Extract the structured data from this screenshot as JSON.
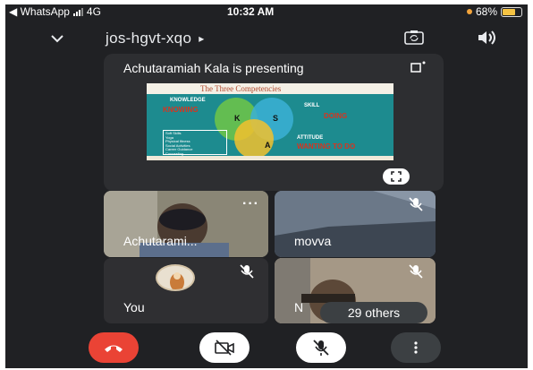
{
  "status_bar": {
    "back_app": "◀ WhatsApp",
    "network": "4G",
    "time": "10:32 AM",
    "battery": "68%",
    "battery_level": 0.68
  },
  "meeting": {
    "code": "jos-hgvt-xqo",
    "code_chevron": "▸"
  },
  "presentation": {
    "title": "Achutaramiah Kala is presenting",
    "slide": {
      "heading": "The Three Competencies",
      "knowledge": "KNOWLEDGE",
      "skill": "SKILL",
      "knowing": "KNOWING",
      "doing": "DOING",
      "attitude": "ATTITUDE",
      "wanting": "WANTING TO DO",
      "k": "K",
      "s": "S",
      "a": "A",
      "box_lines": [
        "Soft Skills",
        "Yoga",
        "Physical fitness",
        "Social Activities",
        "Career Guidance",
        "Counseling"
      ]
    }
  },
  "participants": [
    {
      "name": "Achutarami...",
      "muted": false
    },
    {
      "name": "movva",
      "muted": true
    },
    {
      "name": "You",
      "muted": true
    },
    {
      "name": "N",
      "muted": true
    }
  ],
  "others_label": "29 others",
  "icons": {
    "chevron": "chevron-down-icon",
    "camera_switch": "camera-switch-icon",
    "speaker": "speaker-icon",
    "end_call": "end-call-icon",
    "camera_off": "camera-off-icon",
    "mic_off": "mic-off-icon",
    "more": "more-vertical-icon"
  },
  "colors": {
    "background": "#202124",
    "end_call": "#ea4335",
    "tile": "#3c4043"
  }
}
